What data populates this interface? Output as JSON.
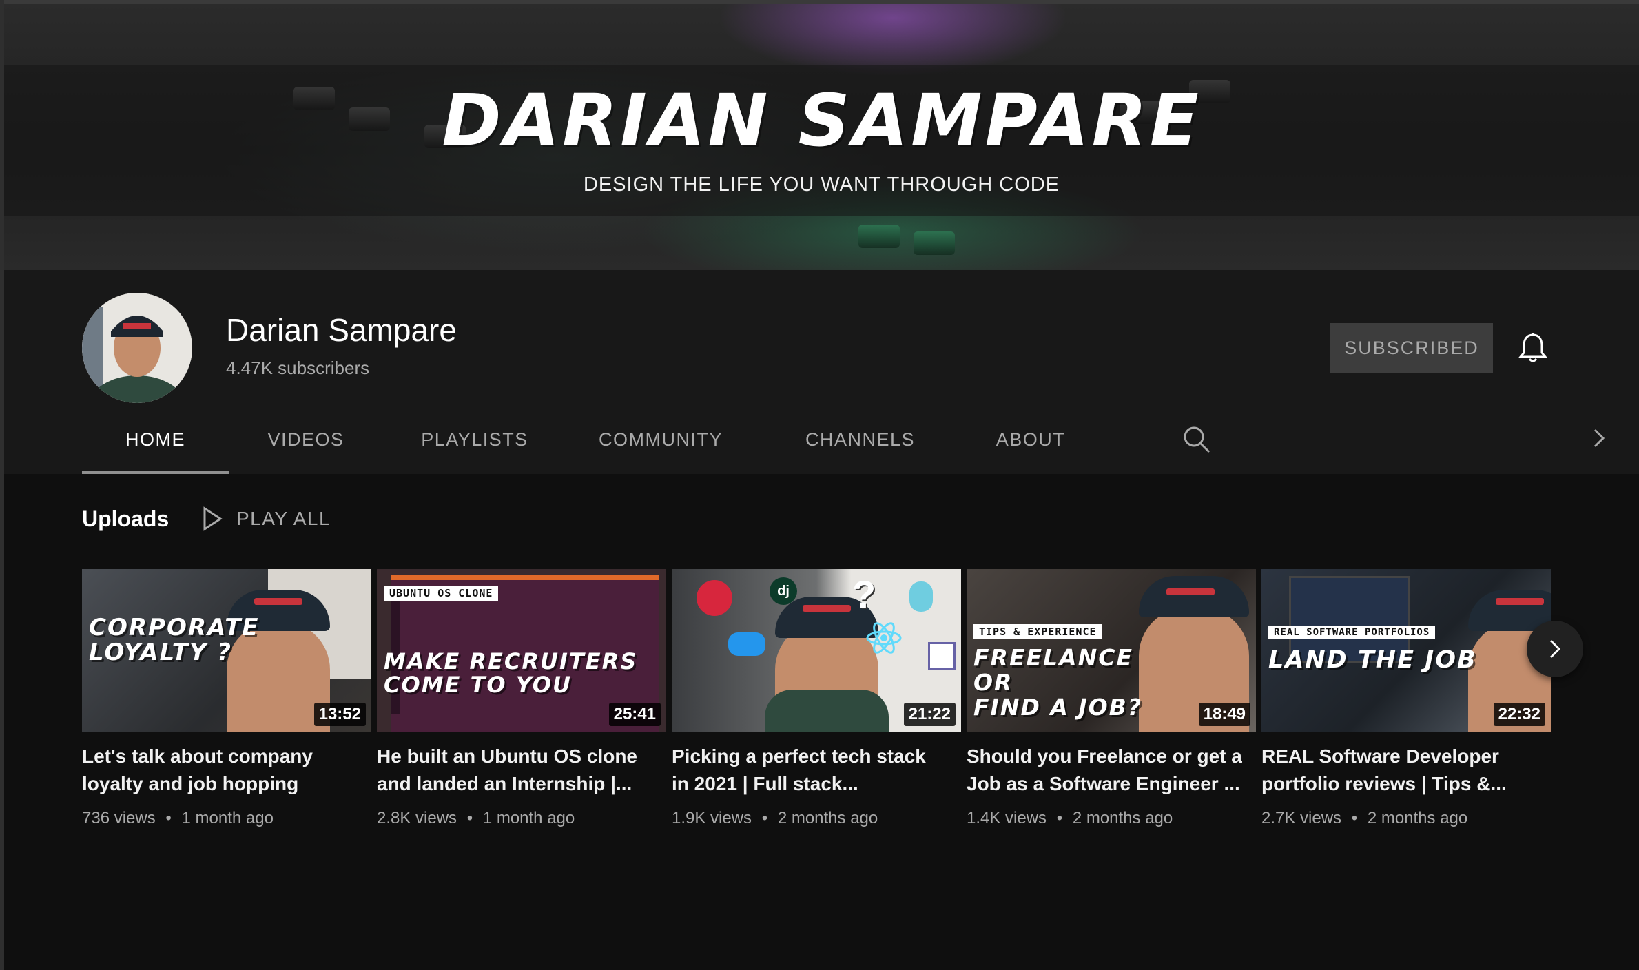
{
  "banner": {
    "title": "DARIAN SAMPARE",
    "tagline": "DESIGN THE LIFE YOU WANT THROUGH CODE"
  },
  "channel": {
    "name": "Darian Sampare",
    "subscribers": "4.47K subscribers",
    "subscribe_label": "SUBSCRIBED",
    "bell_icon": "bell-icon"
  },
  "tabs": [
    "HOME",
    "VIDEOS",
    "PLAYLISTS",
    "COMMUNITY",
    "CHANNELS",
    "ABOUT"
  ],
  "active_tab": "HOME",
  "uploads": {
    "heading": "Uploads",
    "play_all": "PLAY ALL",
    "videos": [
      {
        "title_line1": "Let's talk about company",
        "title_line2": "loyalty and job hopping",
        "thumb_text": [
          "CORPORATE",
          "LOYALTY ?"
        ],
        "chip": "",
        "duration": "13:52",
        "views": "736 views",
        "age": "1 month ago"
      },
      {
        "title_line1": "He built an Ubuntu OS clone",
        "title_line2": "and landed an Internship |...",
        "thumb_text": [
          "MAKE RECRUITERS",
          "COME TO YOU"
        ],
        "chip": "UBUNTU OS CLONE",
        "duration": "25:41",
        "views": "2.8K views",
        "age": "1 month ago"
      },
      {
        "title_line1": "Picking a perfect tech stack",
        "title_line2": "in 2021 | Full stack...",
        "thumb_text": [
          "dj",
          "?"
        ],
        "chip": "",
        "duration": "21:22",
        "views": "1.9K views",
        "age": "2 months ago"
      },
      {
        "title_line1": "Should you Freelance or get a",
        "title_line2": "Job as a Software Engineer ...",
        "thumb_text": [
          "FREELANCE",
          "OR",
          "FIND A JOB?"
        ],
        "chip": "TIPS & EXPERIENCE",
        "duration": "18:49",
        "views": "1.4K views",
        "age": "2 months ago"
      },
      {
        "title_line1": "REAL Software Developer",
        "title_line2": "portfolio reviews | Tips &...",
        "thumb_text": [
          "LAND THE JOB"
        ],
        "chip": "REAL SOFTWARE PORTFOLIOS",
        "duration": "22:32",
        "views": "2.7K views",
        "age": "2 months ago"
      }
    ]
  },
  "meta_separator": "•",
  "colors": {
    "background": "#181818",
    "content_bg": "#0f0f0f",
    "secondary_text": "#aaaaaa",
    "subscribed_bg": "#3d3d3d"
  }
}
